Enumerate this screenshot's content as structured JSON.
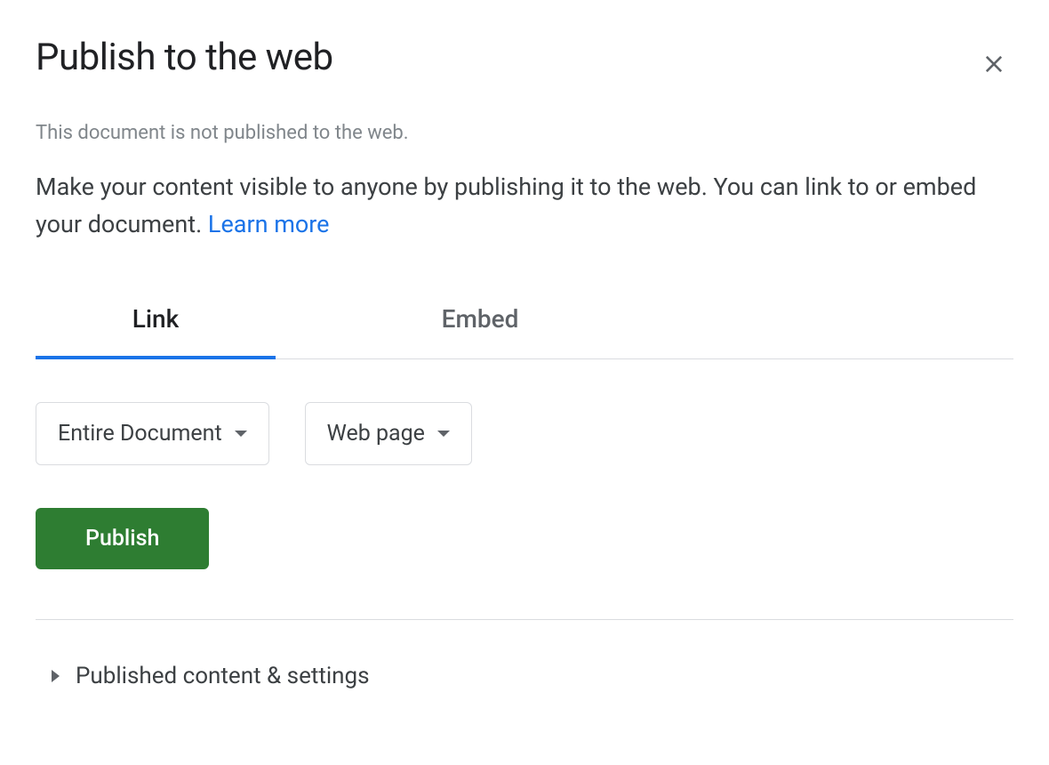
{
  "dialog": {
    "title": "Publish to the web",
    "status": "This document is not published to the web.",
    "description": "Make your content visible to anyone by publishing it to the web. You can link to or embed your document. ",
    "learn_more": "Learn more"
  },
  "tabs": {
    "link": "Link",
    "embed": "Embed",
    "active": "link"
  },
  "dropdowns": {
    "scope": {
      "selected": "Entire Document"
    },
    "format": {
      "selected": "Web page"
    }
  },
  "actions": {
    "publish": "Publish"
  },
  "expand": {
    "label": "Published content & settings"
  },
  "colors": {
    "accent": "#1a73e8",
    "publish_button": "#2e7d32",
    "text_primary": "#202124",
    "text_secondary": "#5f6368"
  }
}
